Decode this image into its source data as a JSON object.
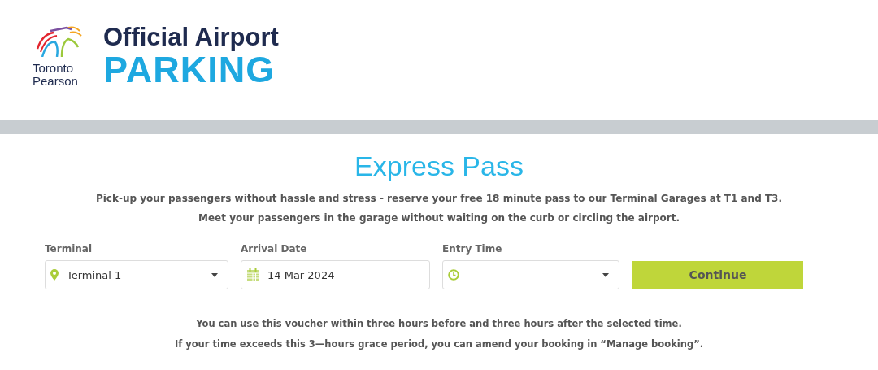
{
  "logo": {
    "org_line_1": "Toronto",
    "org_line_2": "Pearson",
    "title": "Official Airport",
    "subtitle": "PARKING"
  },
  "heading": "Express Pass",
  "intro": [
    "Pick-up your passengers without hassle and stress - reserve your free 18 minute pass to our Terminal Garages at T1 and T3.",
    "Meet your passengers in the garage without waiting on the curb or circling the airport."
  ],
  "form": {
    "fields": [
      {
        "kind": "location",
        "label": "Terminal",
        "value": "Terminal 1"
      },
      {
        "kind": "date",
        "label": "Arrival Date",
        "value": "14 Mar 2024"
      },
      {
        "kind": "time",
        "label": "Entry Time"
      }
    ],
    "button": "Continue"
  },
  "notes": [
    "You can use this voucher within three hours before and three hours after the selected time.",
    "If your time exceeds this 3—hours grace period, you can amend your booking in “Manage booking”."
  ]
}
